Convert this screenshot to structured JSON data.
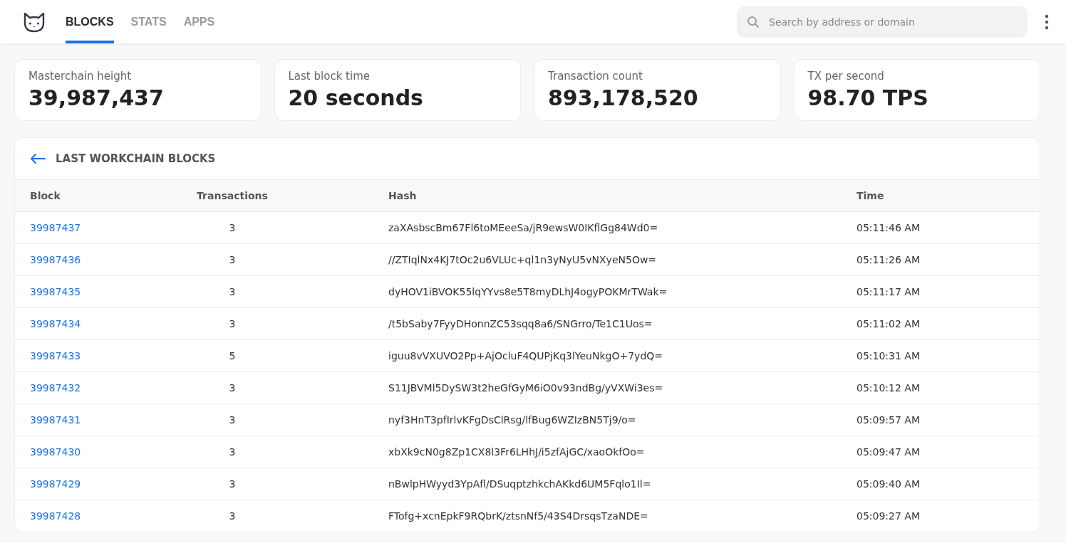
{
  "nav": {
    "tabs": [
      {
        "label": "BLOCKS",
        "selected": true
      },
      {
        "label": "STATS",
        "selected": false
      },
      {
        "label": "APPS",
        "selected": false
      }
    ],
    "search": {
      "placeholder": "Search by address or domain"
    }
  },
  "stats": [
    {
      "label": "Masterchain height",
      "value": "39,987,437"
    },
    {
      "label": "Last block time",
      "value": "20 seconds"
    },
    {
      "label": "Transaction count",
      "value": "893,178,520"
    },
    {
      "label": "TX per second",
      "value": "98.70 TPS"
    }
  ],
  "table": {
    "title": "LAST WORKCHAIN BLOCKS",
    "columns": [
      "Block",
      "Transactions",
      "Hash",
      "Time"
    ],
    "rows": [
      [
        "39987437",
        "3",
        "zaXAsbscBm67Fl6toMEeeSa/jR9ewsW0IKflGg84Wd0=",
        "05:11:46 AM"
      ],
      [
        "39987436",
        "3",
        "//ZTIqlNx4KJ7tOc2u6VLUc+ql1n3yNyU5vNXyeN5Ow=",
        "05:11:26 AM"
      ],
      [
        "39987435",
        "3",
        "dyHOV1iBVOK55lqYYvs8e5T8myDLhJ4ogyPOKMrTWak=",
        "05:11:17 AM"
      ],
      [
        "39987434",
        "3",
        "/t5bSaby7FyyDHonnZC53sqq8a6/SNGrro/Te1C1Uos=",
        "05:11:02 AM"
      ],
      [
        "39987433",
        "5",
        "iguu8vVXUVO2Pp+AjOcluF4QUPjKq3lYeuNkgO+7ydQ=",
        "05:10:31 AM"
      ],
      [
        "39987432",
        "3",
        "S11JBVMl5DySW3t2heGfGyM6iO0v93ndBg/yVXWi3es=",
        "05:10:12 AM"
      ],
      [
        "39987431",
        "3",
        "nyf3HnT3pfIrlvKFgDsClRsg/lfBug6WZIzBN5Tj9/o=",
        "05:09:57 AM"
      ],
      [
        "39987430",
        "3",
        "xbXk9cN0g8Zp1CX8l3Fr6LHhJ/i5zfAjGC/xaoOkfOo=",
        "05:09:47 AM"
      ],
      [
        "39987429",
        "3",
        "nBwlpHWyyd3YpAfl/DSuqptzhkchAKkd6UM5Fqlo1Il=",
        "05:09:40 AM"
      ],
      [
        "39987428",
        "3",
        "FTofg+xcnEpkF9RQbrK/ztsnNf5/43S4DrsqsTzaNDE=",
        "05:09:27 AM"
      ]
    ]
  }
}
